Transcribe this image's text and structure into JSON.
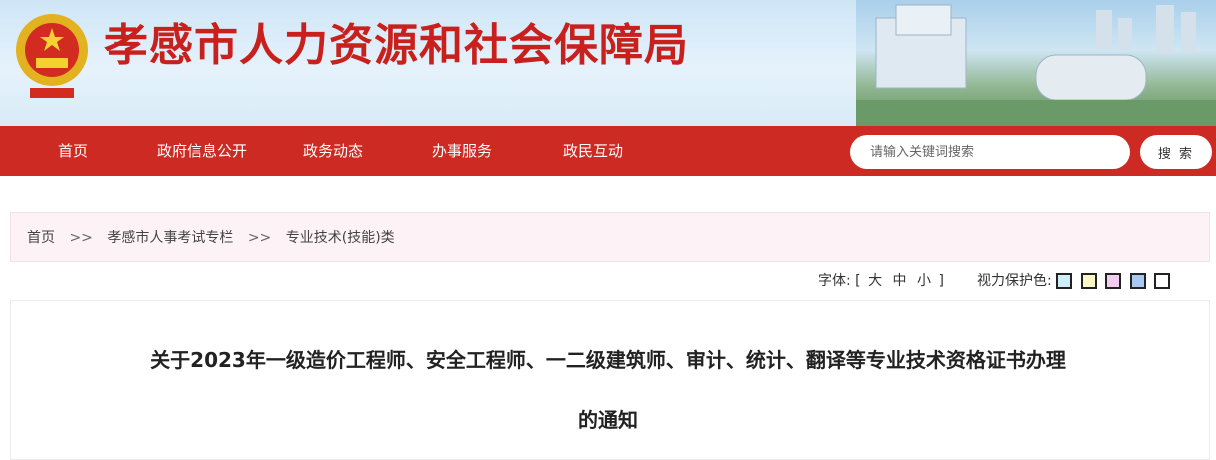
{
  "header": {
    "site_title": "孝感市人力资源和社会保障局",
    "emblem_icon": "national-emblem-icon",
    "title_color": "#c8201c"
  },
  "nav": {
    "items": [
      {
        "label": "首页"
      },
      {
        "label": "政府信息公开"
      },
      {
        "label": "政务动态"
      },
      {
        "label": "办事服务"
      },
      {
        "label": "政民互动"
      }
    ],
    "bar_color": "#cc2a23"
  },
  "search": {
    "placeholder": "请输入关键词搜索",
    "button_label": "搜 索"
  },
  "breadcrumb": {
    "items": [
      "首页",
      "孝感市人事考试专栏",
      "专业技术(技能)类"
    ],
    "separator": ">>"
  },
  "toolbar": {
    "font_label": "字体:",
    "bracket_open": "[",
    "size_large": "大",
    "size_medium": "中",
    "size_small": "小",
    "bracket_close": "]",
    "eye_label": "视力保护色:",
    "swatch_colors": [
      "#cfeef9",
      "#fbf7c7",
      "#f2cdf0",
      "#a9c8f0",
      "#ffffff"
    ]
  },
  "article": {
    "title_line1": "关于2023年一级造价工程师、安全工程师、一二级建筑师、审计、统计、翻译等专业技术资格证书办理",
    "title_line2": "的通知"
  }
}
